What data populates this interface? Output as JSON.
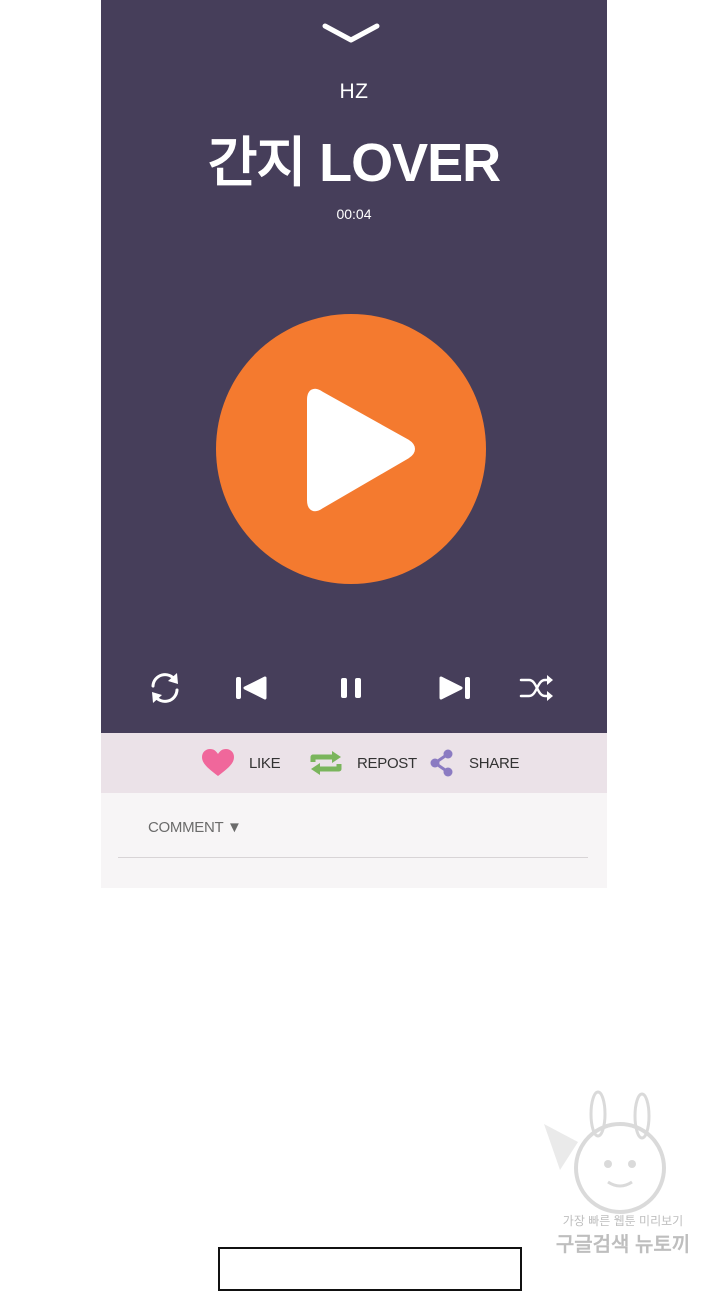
{
  "player": {
    "artist": "HZ",
    "title": "간지 LOVER",
    "time": "00:04",
    "play_button_color": "#f47a2f",
    "background_color": "#463e5a",
    "controls": [
      "repeat-icon",
      "previous-icon",
      "pause-icon",
      "next-icon",
      "shuffle-icon"
    ]
  },
  "actions": {
    "like_label": "LIKE",
    "repost_label": "REPOST",
    "share_label": "SHARE"
  },
  "comments": {
    "toggle_label": "COMMENT ▼"
  },
  "watermark": {
    "line1": "가장 빠른 웹툰 미리보기",
    "line2": "구글검색 뉴토끼"
  }
}
